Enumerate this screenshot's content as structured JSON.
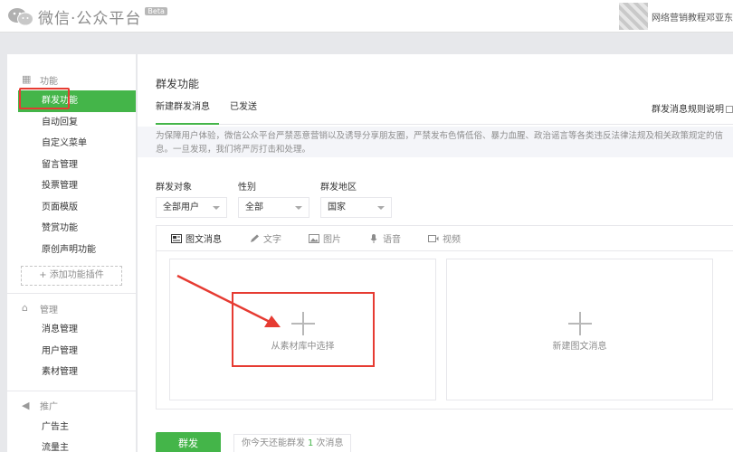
{
  "header": {
    "app_title": "微信·公众平台",
    "beta_badge": "Beta",
    "username": "网络营销教程邓亚东"
  },
  "sidebar": {
    "function_group": {
      "title": "功能",
      "icon": "grid-icon",
      "items": [
        {
          "label": "群发功能",
          "active": true
        },
        {
          "label": "自动回复"
        },
        {
          "label": "自定义菜单"
        },
        {
          "label": "留言管理"
        },
        {
          "label": "投票管理"
        },
        {
          "label": "页面模版"
        },
        {
          "label": "赞赏功能"
        },
        {
          "label": "原创声明功能"
        }
      ],
      "add_plugin": "+ 添加功能插件"
    },
    "manage_group": {
      "title": "管理",
      "icon": "inbox-icon",
      "items": [
        {
          "label": "消息管理"
        },
        {
          "label": "用户管理"
        },
        {
          "label": "素材管理"
        }
      ]
    },
    "promo_group": {
      "title": "推广",
      "icon": "megaphone-icon",
      "items": [
        {
          "label": "广告主"
        },
        {
          "label": "流量主"
        }
      ]
    }
  },
  "main": {
    "title": "群发功能",
    "tabs": [
      {
        "label": "新建群发消息",
        "active": true
      },
      {
        "label": "已发送"
      }
    ],
    "rules_link": "群发消息规则说明",
    "notice_line1": "为保障用户体验，微信公众平台严禁恶意营销以及诱导分享朋友圈，严禁发布色情低俗、暴力血腥、政治谣言等各类违反法律法规及相关政策规定的信",
    "notice_line2": "息。一旦发现，我们将严厉打击和处理。",
    "filters": [
      {
        "label": "群发对象",
        "value": "全部用户"
      },
      {
        "label": "性别",
        "value": "全部"
      },
      {
        "label": "群发地区",
        "value": "国家"
      }
    ],
    "media_tabs": [
      {
        "label": "图文消息",
        "icon": "article-icon",
        "active": true
      },
      {
        "label": "文字",
        "icon": "pencil-icon"
      },
      {
        "label": "图片",
        "icon": "image-icon"
      },
      {
        "label": "语音",
        "icon": "microphone-icon"
      },
      {
        "label": "视频",
        "icon": "video-icon"
      }
    ],
    "cards": [
      {
        "label": "从素材库中选择"
      },
      {
        "label": "新建图文消息"
      }
    ],
    "send_button": "群发",
    "quota_prefix": "你今天还能群发",
    "quota_count": "1",
    "quota_suffix": "次消息"
  },
  "colors": {
    "accent_green": "#44b549",
    "annotation_red": "#e63b32"
  }
}
